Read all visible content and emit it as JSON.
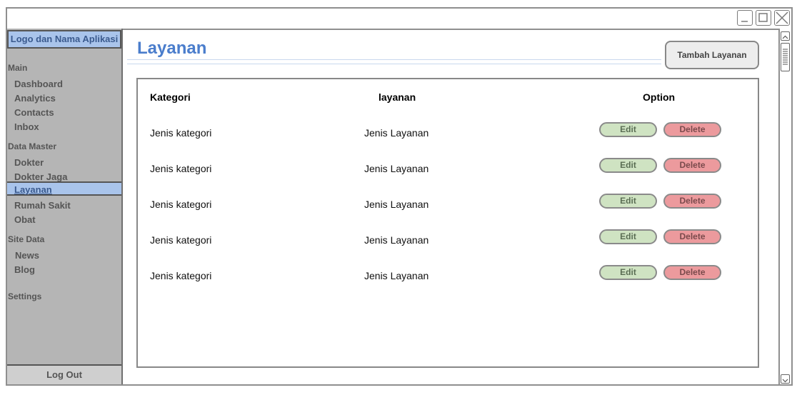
{
  "sidebar": {
    "logo": "Logo dan Nama Aplikasi",
    "sections": [
      {
        "title": "Main",
        "items": [
          "Dashboard",
          "Analytics",
          "Contacts",
          "Inbox"
        ]
      },
      {
        "title": "Data Master",
        "items": [
          "Dokter",
          "Dokter Jaga",
          "Layanan",
          "Rumah Sakit",
          "Obat"
        ]
      },
      {
        "title": "Site Data",
        "items": [
          "News",
          "Blog"
        ]
      },
      {
        "title": "Settings",
        "items": []
      }
    ],
    "active_item": "Layanan",
    "logout": "Log Out"
  },
  "main": {
    "title": "Layanan",
    "add_button": "Tambah Layanan",
    "table": {
      "headers": [
        "Kategori",
        "layanan",
        "Option"
      ],
      "rows": [
        {
          "kategori": "Jenis kategori",
          "layanan": "Jenis Layanan"
        },
        {
          "kategori": "Jenis kategori",
          "layanan": "Jenis Layanan"
        },
        {
          "kategori": "Jenis kategori",
          "layanan": "Jenis Layanan"
        },
        {
          "kategori": "Jenis kategori",
          "layanan": "Jenis Layanan"
        },
        {
          "kategori": "Jenis kategori",
          "layanan": "Jenis Layanan"
        }
      ],
      "edit_label": "Edit",
      "delete_label": "Delete"
    }
  },
  "window": {
    "icons": [
      "minimize-icon",
      "maximize-icon",
      "close-icon"
    ]
  },
  "colors": {
    "accent": "#4a7dcc",
    "sidebar_bg": "#b5b5b5",
    "active_bg": "#a9c4eb",
    "edit_bg": "#cfe3c2",
    "delete_bg": "#ec9a9d"
  }
}
